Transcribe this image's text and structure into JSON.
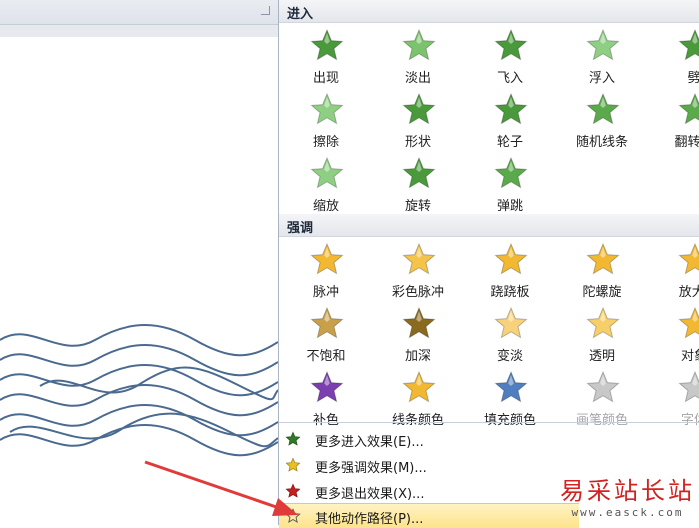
{
  "gallery": {
    "entrance": {
      "header": "进入",
      "items": [
        {
          "label": "出现",
          "icon": "appear-star-icon",
          "color": "#4a9a3c"
        },
        {
          "label": "淡出",
          "icon": "fade-star-icon",
          "color": "#7cc36e"
        },
        {
          "label": "飞入",
          "icon": "fly-in-star-icon",
          "color": "#4a9a3c"
        },
        {
          "label": "浮入",
          "icon": "float-in-star-icon",
          "color": "#8fcf84"
        },
        {
          "label": "劈",
          "icon": "split-star-icon",
          "color": "#4a9a3c"
        },
        {
          "label": "擦除",
          "icon": "wipe-star-icon",
          "color": "#8fcf84"
        },
        {
          "label": "形状",
          "icon": "shape-star-icon",
          "color": "#4a9a3c"
        },
        {
          "label": "轮子",
          "icon": "wheel-star-icon",
          "color": "#4a9a3c"
        },
        {
          "label": "随机线条",
          "icon": "random-bars-star-icon",
          "color": "#5aaa4c"
        },
        {
          "label": "翻转式",
          "icon": "flip-star-icon",
          "color": "#5aaa4c"
        },
        {
          "label": "缩放",
          "icon": "zoom-star-icon",
          "color": "#8fcf84"
        },
        {
          "label": "旋转",
          "icon": "swivel-star-icon",
          "color": "#4a9a3c"
        },
        {
          "label": "弹跳",
          "icon": "bounce-star-icon",
          "color": "#5aaa4c"
        }
      ]
    },
    "emphasis": {
      "header": "强调",
      "items": [
        {
          "label": "脉冲",
          "icon": "pulse-star-icon",
          "color": "#f2b832"
        },
        {
          "label": "彩色脉冲",
          "icon": "color-pulse-star-icon",
          "color": "#f4c34a"
        },
        {
          "label": "跷跷板",
          "icon": "teeter-star-icon",
          "color": "#f2b832"
        },
        {
          "label": "陀螺旋",
          "icon": "spin-star-icon",
          "color": "#f2b832"
        },
        {
          "label": "放大/",
          "icon": "grow-shrink-star-icon",
          "color": "#f2b832"
        },
        {
          "label": "不饱和",
          "icon": "desaturate-star-icon",
          "color": "#c9a04a"
        },
        {
          "label": "加深",
          "icon": "darken-star-icon",
          "color": "#8a6a1e"
        },
        {
          "label": "变淡",
          "icon": "lighten-star-icon",
          "color": "#f7d27a"
        },
        {
          "label": "透明",
          "icon": "transparency-star-icon",
          "color": "#f6cf6a"
        },
        {
          "label": "对象",
          "icon": "object-color-star-icon",
          "color": "#f2b832"
        },
        {
          "label": "补色",
          "icon": "complementary-color-star-icon",
          "color": "#7b3fb0"
        },
        {
          "label": "线条颜色",
          "icon": "line-color-star-icon",
          "color": "#f2b832"
        },
        {
          "label": "填充颜色",
          "icon": "fill-color-star-icon",
          "color": "#4f7fc0"
        },
        {
          "label": "画笔颜色",
          "icon": "brush-color-star-icon",
          "color": "#c8c8c8",
          "disabled": true
        },
        {
          "label": "字体",
          "icon": "font-color-star-icon",
          "color": "#c8c8c8",
          "disabled": true
        }
      ]
    }
  },
  "menu": {
    "more_entrance": "更多进入效果(E)...",
    "more_emphasis": "更多强调效果(M)...",
    "more_exit": "更多退出效果(X)...",
    "more_motion_paths": "其他动作路径(P)..."
  },
  "watermark": {
    "main": "易采站长站",
    "sub": "www.easck.com"
  },
  "colors": {
    "highlight": "#fde38a",
    "wave_stroke": "#4b6a90",
    "arrow": "#e03a3a"
  }
}
